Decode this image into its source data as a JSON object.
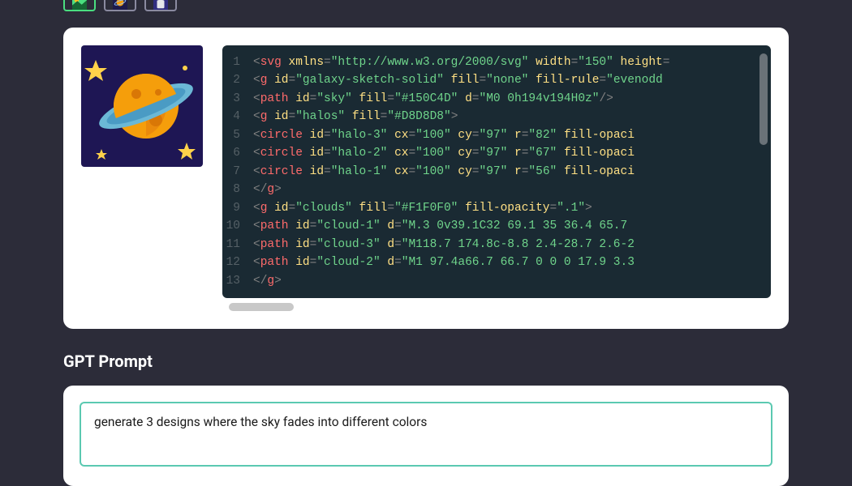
{
  "thumbnails": {
    "selected_index": 0
  },
  "code": {
    "lines": [
      {
        "n": "1",
        "tokens": [
          [
            "p",
            "<"
          ],
          [
            "t",
            "svg"
          ],
          [
            "p",
            " "
          ],
          [
            "an",
            "xmlns"
          ],
          [
            "p",
            "="
          ],
          [
            "av",
            "\"http://www.w3.org/2000/svg\""
          ],
          [
            "p",
            " "
          ],
          [
            "an",
            "width"
          ],
          [
            "p",
            "="
          ],
          [
            "av",
            "\"150\""
          ],
          [
            "p",
            " "
          ],
          [
            "an",
            "height"
          ],
          [
            "p",
            "="
          ]
        ]
      },
      {
        "n": "2",
        "tokens": [
          [
            "p",
            "<"
          ],
          [
            "t",
            "g"
          ],
          [
            "p",
            " "
          ],
          [
            "an",
            "id"
          ],
          [
            "p",
            "="
          ],
          [
            "av",
            "\"galaxy-sketch-solid\""
          ],
          [
            "p",
            " "
          ],
          [
            "an",
            "fill"
          ],
          [
            "p",
            "="
          ],
          [
            "av",
            "\"none\""
          ],
          [
            "p",
            " "
          ],
          [
            "an",
            "fill-rule"
          ],
          [
            "p",
            "="
          ],
          [
            "av",
            "\"evenodd"
          ]
        ]
      },
      {
        "n": "3",
        "tokens": [
          [
            "p",
            "  <"
          ],
          [
            "t",
            "path"
          ],
          [
            "p",
            " "
          ],
          [
            "an",
            "id"
          ],
          [
            "p",
            "="
          ],
          [
            "av",
            "\"sky\""
          ],
          [
            "p",
            " "
          ],
          [
            "an",
            "fill"
          ],
          [
            "p",
            "="
          ],
          [
            "av",
            "\"#150C4D\""
          ],
          [
            "p",
            " "
          ],
          [
            "an",
            "d"
          ],
          [
            "p",
            "="
          ],
          [
            "av",
            "\"M0 0h194v194H0z\""
          ],
          [
            "p",
            "/>"
          ]
        ]
      },
      {
        "n": "4",
        "tokens": [
          [
            "p",
            "  <"
          ],
          [
            "t",
            "g"
          ],
          [
            "p",
            " "
          ],
          [
            "an",
            "id"
          ],
          [
            "p",
            "="
          ],
          [
            "av",
            "\"halos\""
          ],
          [
            "p",
            " "
          ],
          [
            "an",
            "fill"
          ],
          [
            "p",
            "="
          ],
          [
            "av",
            "\"#D8D8D8\""
          ],
          [
            "p",
            ">"
          ]
        ]
      },
      {
        "n": "5",
        "tokens": [
          [
            "p",
            "    <"
          ],
          [
            "t",
            "circle"
          ],
          [
            "p",
            " "
          ],
          [
            "an",
            "id"
          ],
          [
            "p",
            "="
          ],
          [
            "av",
            "\"halo-3\""
          ],
          [
            "p",
            " "
          ],
          [
            "an",
            "cx"
          ],
          [
            "p",
            "="
          ],
          [
            "av",
            "\"100\""
          ],
          [
            "p",
            " "
          ],
          [
            "an",
            "cy"
          ],
          [
            "p",
            "="
          ],
          [
            "av",
            "\"97\""
          ],
          [
            "p",
            " "
          ],
          [
            "an",
            "r"
          ],
          [
            "p",
            "="
          ],
          [
            "av",
            "\"82\""
          ],
          [
            "p",
            " "
          ],
          [
            "an",
            "fill-opaci"
          ]
        ]
      },
      {
        "n": "6",
        "tokens": [
          [
            "p",
            "    <"
          ],
          [
            "t",
            "circle"
          ],
          [
            "p",
            " "
          ],
          [
            "an",
            "id"
          ],
          [
            "p",
            "="
          ],
          [
            "av",
            "\"halo-2\""
          ],
          [
            "p",
            " "
          ],
          [
            "an",
            "cx"
          ],
          [
            "p",
            "="
          ],
          [
            "av",
            "\"100\""
          ],
          [
            "p",
            " "
          ],
          [
            "an",
            "cy"
          ],
          [
            "p",
            "="
          ],
          [
            "av",
            "\"97\""
          ],
          [
            "p",
            " "
          ],
          [
            "an",
            "r"
          ],
          [
            "p",
            "="
          ],
          [
            "av",
            "\"67\""
          ],
          [
            "p",
            " "
          ],
          [
            "an",
            "fill-opaci"
          ]
        ]
      },
      {
        "n": "7",
        "tokens": [
          [
            "p",
            "    <"
          ],
          [
            "t",
            "circle"
          ],
          [
            "p",
            " "
          ],
          [
            "an",
            "id"
          ],
          [
            "p",
            "="
          ],
          [
            "av",
            "\"halo-1\""
          ],
          [
            "p",
            " "
          ],
          [
            "an",
            "cx"
          ],
          [
            "p",
            "="
          ],
          [
            "av",
            "\"100\""
          ],
          [
            "p",
            " "
          ],
          [
            "an",
            "cy"
          ],
          [
            "p",
            "="
          ],
          [
            "av",
            "\"97\""
          ],
          [
            "p",
            " "
          ],
          [
            "an",
            "r"
          ],
          [
            "p",
            "="
          ],
          [
            "av",
            "\"56\""
          ],
          [
            "p",
            " "
          ],
          [
            "an",
            "fill-opaci"
          ]
        ]
      },
      {
        "n": "8",
        "tokens": [
          [
            "p",
            "  </"
          ],
          [
            "t",
            "g"
          ],
          [
            "p",
            ">"
          ]
        ]
      },
      {
        "n": "9",
        "tokens": [
          [
            "p",
            "  <"
          ],
          [
            "t",
            "g"
          ],
          [
            "p",
            " "
          ],
          [
            "an",
            "id"
          ],
          [
            "p",
            "="
          ],
          [
            "av",
            "\"clouds\""
          ],
          [
            "p",
            " "
          ],
          [
            "an",
            "fill"
          ],
          [
            "p",
            "="
          ],
          [
            "av",
            "\"#F1F0F0\""
          ],
          [
            "p",
            " "
          ],
          [
            "an",
            "fill-opacity"
          ],
          [
            "p",
            "="
          ],
          [
            "av",
            "\".1\""
          ],
          [
            "p",
            ">"
          ]
        ]
      },
      {
        "n": "10",
        "tokens": [
          [
            "p",
            "    <"
          ],
          [
            "t",
            "path"
          ],
          [
            "p",
            " "
          ],
          [
            "an",
            "id"
          ],
          [
            "p",
            "="
          ],
          [
            "av",
            "\"cloud-1\""
          ],
          [
            "p",
            " "
          ],
          [
            "an",
            "d"
          ],
          [
            "p",
            "="
          ],
          [
            "av",
            "\"M.3 0v39.1C32 69.1 35 36.4 65.7 "
          ]
        ]
      },
      {
        "n": "11",
        "tokens": [
          [
            "p",
            "    <"
          ],
          [
            "t",
            "path"
          ],
          [
            "p",
            " "
          ],
          [
            "an",
            "id"
          ],
          [
            "p",
            "="
          ],
          [
            "av",
            "\"cloud-3\""
          ],
          [
            "p",
            " "
          ],
          [
            "an",
            "d"
          ],
          [
            "p",
            "="
          ],
          [
            "av",
            "\"M118.7 174.8c-8.8 2.4-28.7 2.6-2"
          ]
        ]
      },
      {
        "n": "12",
        "tokens": [
          [
            "p",
            "    <"
          ],
          [
            "t",
            "path"
          ],
          [
            "p",
            " "
          ],
          [
            "an",
            "id"
          ],
          [
            "p",
            "="
          ],
          [
            "av",
            "\"cloud-2\""
          ],
          [
            "p",
            " "
          ],
          [
            "an",
            "d"
          ],
          [
            "p",
            "="
          ],
          [
            "av",
            "\"M1 97.4a66.7 66.7 0 0 0 17.9 3.3"
          ]
        ]
      },
      {
        "n": "13",
        "tokens": [
          [
            "p",
            "  </"
          ],
          [
            "t",
            "g"
          ],
          [
            "p",
            ">"
          ]
        ]
      }
    ]
  },
  "section": {
    "title": "GPT Prompt"
  },
  "prompt": {
    "value": "generate 3 designs where the sky fades into different colors"
  },
  "colors": {
    "page_bg": "#2c2c39",
    "card_bg": "#ffffff",
    "code_bg": "#1a2a33",
    "accent_border": "#5bc9b1"
  }
}
